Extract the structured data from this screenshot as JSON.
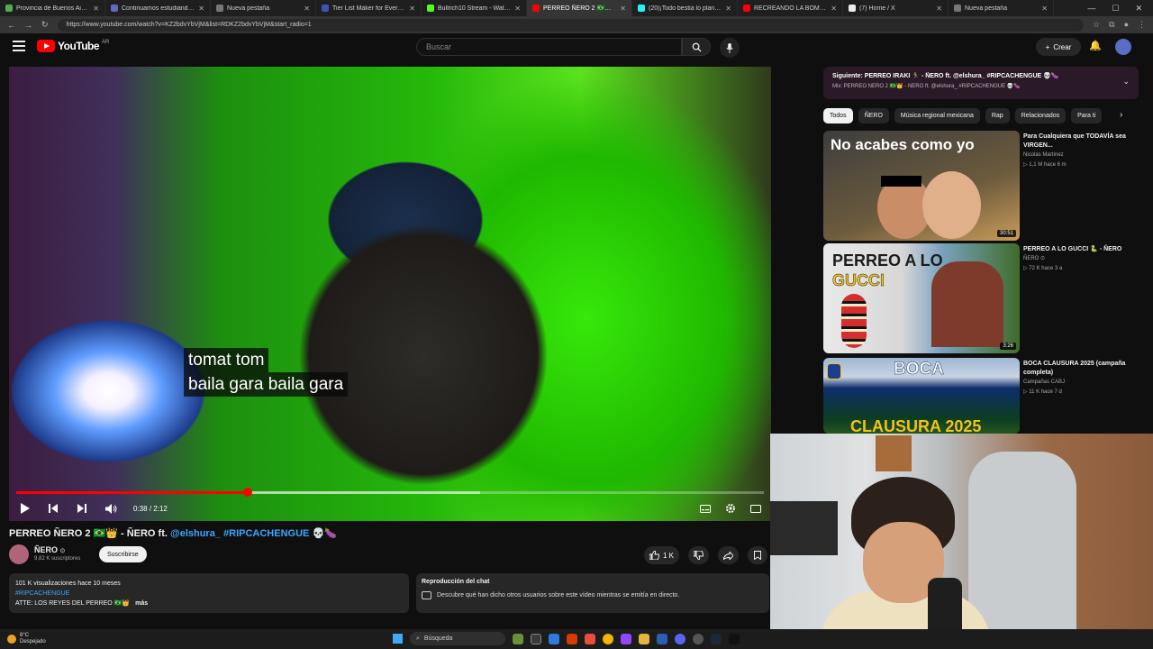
{
  "browser": {
    "tabs": [
      {
        "title": "Provincia de Buenos Aires |",
        "color": "#4caf50",
        "active": false
      },
      {
        "title": "Continuamos estudiando – Plat",
        "color": "#5c6bc0",
        "active": false
      },
      {
        "title": "Nueva pestaña",
        "color": "#777777",
        "active": false
      },
      {
        "title": "Tier List Maker for Everything",
        "color": "#3f51b5",
        "active": false
      },
      {
        "title": "Bullrich10 Stream - Watch Live",
        "color": "#53fc18",
        "active": false
      },
      {
        "title": "PERREO ÑERO 2 🇧🇷👑 - ÑERO",
        "color": "#ff0000",
        "active": true
      },
      {
        "title": "(20)¡Todo bestia lo plante acá",
        "color": "#25f4ee",
        "active": false
      },
      {
        "title": "RECREANDO LA BOMBONERA",
        "color": "#ff0000",
        "active": false
      },
      {
        "title": "(7) Home / X",
        "color": "#eeeeee",
        "active": false
      },
      {
        "title": "Nueva pestaña",
        "color": "#777777",
        "active": false
      }
    ],
    "url": "https://www.youtube.com/watch?v=KZ2bdvYbVjM&list=RDKZ2bdvYbVjM&start_radio=1"
  },
  "header": {
    "logo_text": "YouTube",
    "logo_country": "AR",
    "search_placeholder": "Buscar",
    "create_label": "Crear"
  },
  "player": {
    "subtitle_line1": "tomat tom",
    "subtitle_line2": "baila gara baila gara",
    "time_current": "0:38",
    "time_total": "2:12",
    "time_separator": "/",
    "played_fraction": 0.31,
    "loaded_fraction": 0.62
  },
  "video": {
    "title": "PERREO ÑERO 2 🇧🇷👑 - ÑERO ft. ",
    "title_mention": "@elshura_",
    "title_hashtag": "#RIPCACHENGUE",
    "title_suffix": "💀🍆",
    "channel_name": "ÑERO",
    "channel_subs": "9,82 K suscriptores",
    "subscribe_label": "Suscribirse",
    "likes": "1 K"
  },
  "description": {
    "stats": "101 K visualizaciones  hace 10 meses",
    "hashtag": "#RIPCACHENGUE",
    "text": "ATTE: LOS REYES DEL PERREO 🇧🇷👑",
    "more": "más"
  },
  "chat": {
    "title": "Reproducción del chat",
    "text": "Descubre qué han dicho otros usuarios sobre este vídeo mientras se emitía en directo."
  },
  "sidebar": {
    "up_next_line1": "Siguiente: PERREO IRAKI 🏃‍♂️ - ÑERO ft. @elshura_ #RIPCACHENGUE 💀🍆",
    "up_next_line2": "Mix: PERREO ÑERO 2 🇧🇷👑 - ÑERO ft. @elshura_ #RIPCACHENGUE 💀🍆",
    "chips": [
      "Todos",
      "ÑERO",
      "Música regional mexicana",
      "Rap",
      "Relacionados",
      "Para ti"
    ],
    "recommendations": [
      {
        "title": "Para Cualquiera que TODAVÍA sea VIRGEN...",
        "channel": "Nicolás Martínez",
        "meta": "▷ 1,1 M  hace 6 m",
        "duration": "30:51",
        "thumb_text": "No acabes como yo"
      },
      {
        "title": "PERREO A LO GUCCI 🐍 - ÑERO",
        "channel": "ÑERO ⊙",
        "meta": "▷ 72 K  hace 3 a",
        "duration": "3:26",
        "thumb_text": "PERREO A LO",
        "thumb_text2": "GUCCI"
      },
      {
        "title": "BOCA CLAUSURA 2025 (campaña completa)",
        "channel": "Campañas CABJ",
        "meta": "▷ 11 K  hace 7 d",
        "duration": "",
        "thumb_text": "BOCA",
        "thumb_text2": "CLAUSURA 2025"
      }
    ]
  },
  "taskbar": {
    "temp": "8°C",
    "weather": "Despejado",
    "search": "Búsqueda"
  }
}
